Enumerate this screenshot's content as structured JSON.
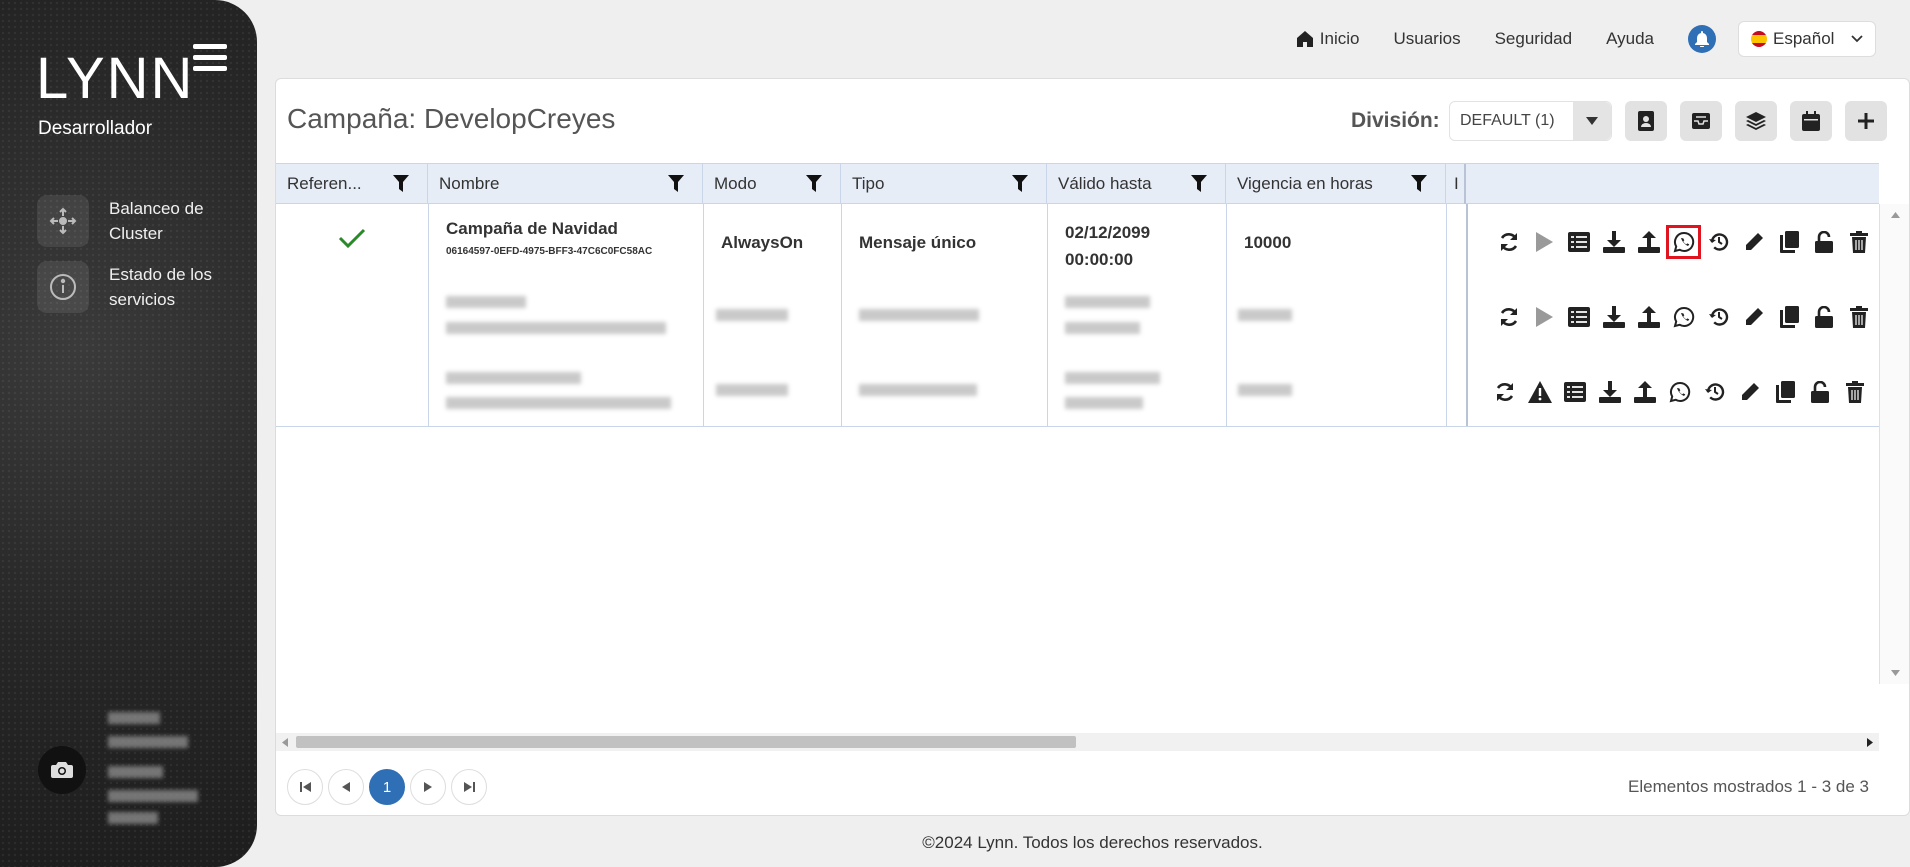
{
  "sidebar": {
    "logo": "LYNN",
    "role": "Desarrollador",
    "items": [
      {
        "label": "Balanceo de Cluster",
        "icon": "cluster-icon"
      },
      {
        "label": "Estado de los servicios",
        "icon": "info-icon"
      }
    ]
  },
  "topnav": {
    "home": "Inicio",
    "users": "Usuarios",
    "security": "Seguridad",
    "help": "Ayuda",
    "language": "Español"
  },
  "header": {
    "title": "Campaña: DevelopCreyes",
    "division_label": "División:",
    "division_value": "DEFAULT (1)"
  },
  "table": {
    "columns": [
      "Referen...",
      "Nombre",
      "Modo",
      "Tipo",
      "Válido hasta",
      "Vigencia en horas",
      "I"
    ],
    "rows": [
      {
        "reference": "✓",
        "name": "Campaña de Navidad",
        "id": "06164597-0EFD-4975-BFF3-47C6C0FC58AC",
        "mode": "AlwaysOn",
        "type": "Mensaje único",
        "valid_until": "02/12/2099 00:00:00",
        "hours": "10000"
      }
    ],
    "action_icons": [
      "refresh-icon",
      "play-icon",
      "list-icon",
      "download-icon",
      "upload-icon",
      "whatsapp-icon",
      "history-icon",
      "edit-icon",
      "copy-icon",
      "unlock-icon",
      "trash-icon"
    ]
  },
  "pager": {
    "current": "1",
    "summary": "Elementos mostrados 1 - 3 de 3"
  },
  "footer": "©2024 Lynn. Todos los derechos reservados.",
  "colors": {
    "accent": "#2f6fb5",
    "header_bg": "#e6edf7",
    "highlight": "#e0141e",
    "check": "#2a8a2a"
  }
}
